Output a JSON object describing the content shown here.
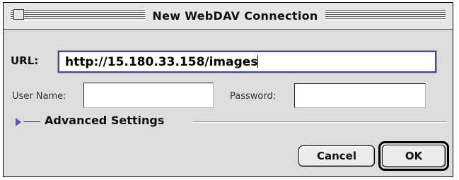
{
  "window": {
    "title": "New WebDAV Connection"
  },
  "form": {
    "url_label": "URL:",
    "url_value": "http://15.180.33.158/images",
    "user_name_label": "User Name:",
    "user_name_value": "",
    "password_label": "Password:",
    "password_value": ""
  },
  "advanced": {
    "label": "Advanced Settings",
    "expanded": false
  },
  "buttons": {
    "cancel_label": "Cancel",
    "ok_label": "OK"
  },
  "icons": [
    "close-box-icon",
    "disclosure-triangle-icon"
  ]
}
